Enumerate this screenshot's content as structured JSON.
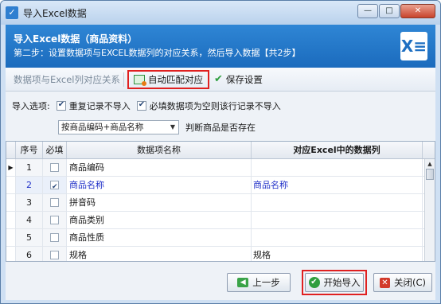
{
  "window": {
    "title": "导入Excel数据",
    "title_icon": "app-icon",
    "btn_min": "—",
    "btn_max": "□",
    "btn_close": "✕"
  },
  "header": {
    "title": "导入Excel数据（商品资料）",
    "subtitle": "第二步：设置数据项与EXCEL数据列的对应关系，然后导入数据【共2步】",
    "logo_text": "X≡"
  },
  "toolbar": {
    "label": "数据项与Excel列对应关系",
    "auto_match": "自动匹配对应",
    "save_settings": "保存设置"
  },
  "options": {
    "label": "导入选项:",
    "opt1": "重复记录不导入",
    "opt1_checked": true,
    "opt2": "必填数据项为空则该行记录不导入",
    "opt2_checked": true
  },
  "match": {
    "select_value": "按商品编码+商品名称",
    "label": "判断商品是否存在"
  },
  "grid": {
    "headers": [
      "序号",
      "必填",
      "数据项名称",
      "对应Excel中的数据列"
    ],
    "rows": [
      {
        "no": "1",
        "required": false,
        "name": "商品编码",
        "excel_col": ""
      },
      {
        "no": "2",
        "required": true,
        "name": "商品名称",
        "excel_col": "商品名称"
      },
      {
        "no": "3",
        "required": false,
        "name": "拼音码",
        "excel_col": ""
      },
      {
        "no": "4",
        "required": false,
        "name": "商品类别",
        "excel_col": ""
      },
      {
        "no": "5",
        "required": false,
        "name": "商品性质",
        "excel_col": ""
      },
      {
        "no": "6",
        "required": false,
        "name": "规格",
        "excel_col": "规格"
      }
    ]
  },
  "footer": {
    "prev": "上一步",
    "start": "开始导入",
    "close": "关闭(C)"
  },
  "colors": {
    "header_blue": "#1b6bbd",
    "highlight_red": "#e02020",
    "selected_text": "#2030c8"
  }
}
